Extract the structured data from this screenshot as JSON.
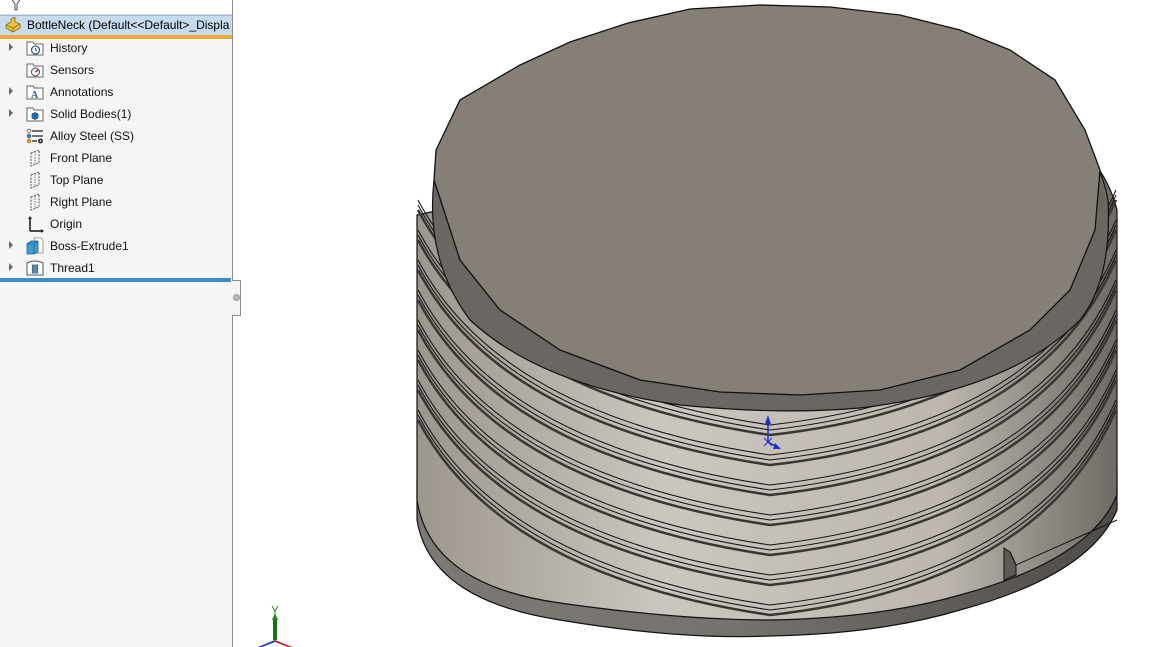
{
  "feature_tree": {
    "filter_icon": "funnel-icon",
    "root": {
      "icon": "part-icon",
      "label": "BottleNeck  (Default<<Default>_Displa"
    },
    "items": [
      {
        "label": "History",
        "icon": "history-folder-icon",
        "expandable": true
      },
      {
        "label": "Sensors",
        "icon": "sensors-folder-icon",
        "expandable": false
      },
      {
        "label": "Annotations",
        "icon": "annotations-folder-icon",
        "expandable": true
      },
      {
        "label": "Solid Bodies(1)",
        "icon": "solid-bodies-folder-icon",
        "expandable": true
      },
      {
        "label": "Alloy Steel (SS)",
        "icon": "material-icon",
        "expandable": false
      },
      {
        "label": "Front Plane",
        "icon": "plane-icon",
        "expandable": false
      },
      {
        "label": "Top Plane",
        "icon": "plane-icon",
        "expandable": false
      },
      {
        "label": "Right Plane",
        "icon": "plane-icon",
        "expandable": false
      },
      {
        "label": "Origin",
        "icon": "origin-icon",
        "expandable": false
      },
      {
        "label": "Boss-Extrude1",
        "icon": "boss-extrude-icon",
        "expandable": true
      },
      {
        "label": "Thread1",
        "icon": "thread-icon",
        "expandable": true
      }
    ]
  },
  "viewport": {
    "model_name": "BottleNeck",
    "material": "Alloy Steel (SS)",
    "colors": {
      "top_face": "#857f78",
      "thread_light": "#cdc8c1",
      "thread_dark": "#6f6a64",
      "base_band": "#6e6a65",
      "edge": "#111111",
      "origin_axis": "#1a2fd6"
    },
    "triad_axes": [
      "Y",
      "X",
      "Z"
    ]
  }
}
